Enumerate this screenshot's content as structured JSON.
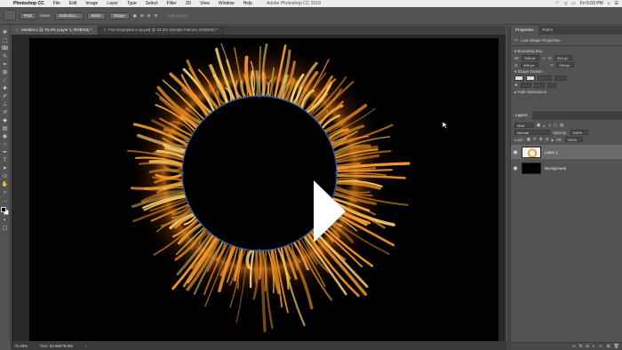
{
  "menubar": {
    "app_name": "Photoshop CC",
    "items": [
      "File",
      "Edit",
      "Image",
      "Layer",
      "Type",
      "Select",
      "Filter",
      "3D",
      "View",
      "Window",
      "Help"
    ],
    "window_title": "Adobe Photoshop CC 2018",
    "clock": "Fri 5:03 PM"
  },
  "options_bar": {
    "mode": "Path",
    "make_label": "Make:",
    "selection_btn": "Selection...",
    "mask_btn": "Mask",
    "shape_btn": "Shape",
    "align_edges": "Align Edges"
  },
  "tabs": [
    {
      "title": "Untitled-1 @ 76.3% (Layer 1, RGB/16) *",
      "active": true
    },
    {
      "title": "Fire Examples A.sp.psd @ 33.3% (Simple Flames, RGB/16) *",
      "active": false
    }
  ],
  "statusbar": {
    "zoom": "76.29%",
    "doc": "Doc: 52.9M/78.9M"
  },
  "properties": {
    "tab_properties": "Properties",
    "tab_paths": "Paths",
    "heading": "Live Shape Properties",
    "bounding_box": "Bounding Box",
    "w_label": "W:",
    "w_value": "348 px",
    "h_label": "H:",
    "h_value": "612 px",
    "x_label": "X:",
    "x_value": "400 px",
    "y_label": "Y:",
    "y_value": "234 px",
    "shape_details": "Shape Details",
    "path_operations": "Path Operations"
  },
  "layers": {
    "tab": "Layers",
    "kind": "Kind",
    "blend": "Normal",
    "opacity_label": "Opacity:",
    "opacity_value": "100%",
    "lock_label": "Lock:",
    "fill_label": "Fill:",
    "fill_value": "100%",
    "items": [
      {
        "name": "Layer 1",
        "selected": true
      },
      {
        "name": "Background",
        "selected": false
      }
    ]
  },
  "colors": {
    "fire_orange": "#f59a2a",
    "fire_yellow": "#ffd36b",
    "path_blue": "#2f5fae"
  }
}
